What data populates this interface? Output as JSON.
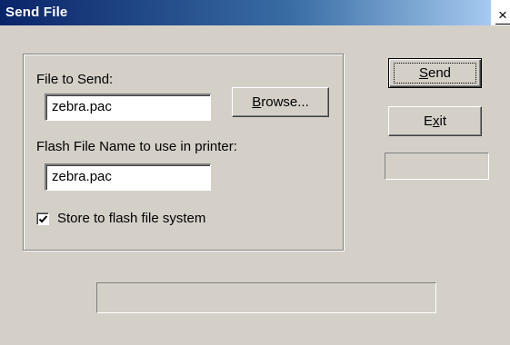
{
  "window": {
    "title": "Send File",
    "close_glyph": "✕",
    "close_icon": "close-icon"
  },
  "form": {
    "file_to_send_label": "File to Send:",
    "file_to_send_value": "zebra.pac",
    "browse_label_pre": "",
    "browse_label_mnemonic": "B",
    "browse_label_post": "rowse...",
    "flash_name_label": "Flash File Name to use in printer:",
    "flash_name_value": "zebra.pac",
    "store_checkbox_label": "Store to flash file system",
    "store_checkbox_checked": true
  },
  "actions": {
    "send_mnemonic": "S",
    "send_post": "end",
    "exit_pre": "E",
    "exit_mnemonic": "x",
    "exit_post": "it"
  },
  "status": {
    "small_panel_text": "",
    "progress_text": ""
  },
  "colors": {
    "dialog_bg": "#d4d0c8",
    "title_start": "#0a246a",
    "title_end": "#a6caf0"
  }
}
